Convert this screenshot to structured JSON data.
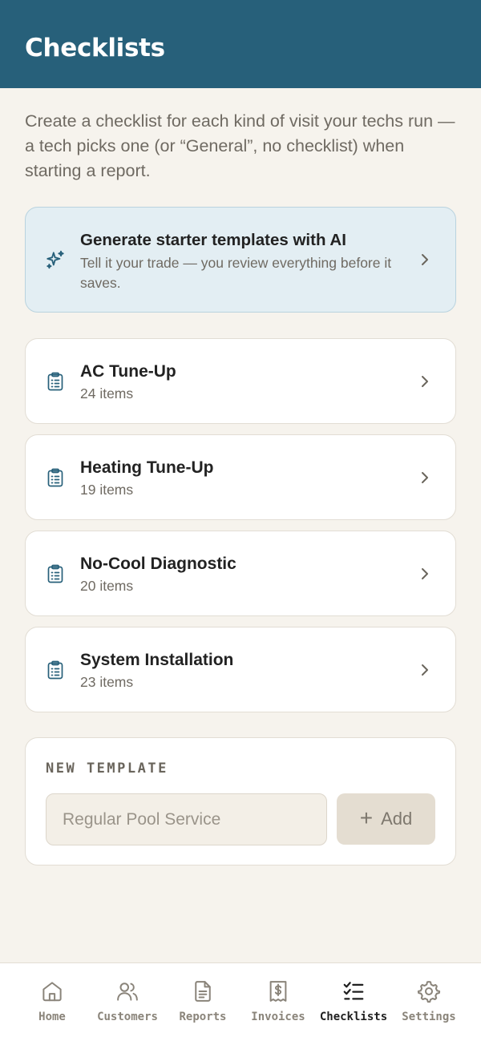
{
  "header": {
    "title": "Checklists"
  },
  "intro": "Create a checklist for each kind of visit your techs run — a tech picks one (or “General”, no checklist) when starting a report.",
  "ai_card": {
    "icon": "sparkles-icon",
    "title": "Generate starter templates with AI",
    "subtitle": "Tell it your trade — you review everything before it saves."
  },
  "templates": [
    {
      "name": "AC Tune-Up",
      "count": "24 items",
      "icon": "clipboard-icon"
    },
    {
      "name": "Heating Tune-Up",
      "count": "19 items",
      "icon": "clipboard-icon"
    },
    {
      "name": "No-Cool Diagnostic",
      "count": "20 items",
      "icon": "clipboard-icon"
    },
    {
      "name": "System Installation",
      "count": "23 items",
      "icon": "clipboard-icon"
    }
  ],
  "new_template": {
    "label": "NEW TEMPLATE",
    "placeholder": "Regular Pool Service",
    "value": "",
    "add_label": "Add",
    "add_icon": "plus-icon"
  },
  "tabs": [
    {
      "label": "Home",
      "icon": "home-icon",
      "active": false
    },
    {
      "label": "Customers",
      "icon": "users-icon",
      "active": false
    },
    {
      "label": "Reports",
      "icon": "document-icon",
      "active": false
    },
    {
      "label": "Invoices",
      "icon": "receipt-icon",
      "active": false
    },
    {
      "label": "Checklists",
      "icon": "checklist-icon",
      "active": true
    },
    {
      "label": "Settings",
      "icon": "gear-icon",
      "active": false
    }
  ],
  "colors": {
    "header_bg": "#27607a",
    "page_bg": "#f6f3ed",
    "accent": "#27607a",
    "ai_card_bg": "#e3eef3",
    "muted_text": "#6f6a62"
  }
}
